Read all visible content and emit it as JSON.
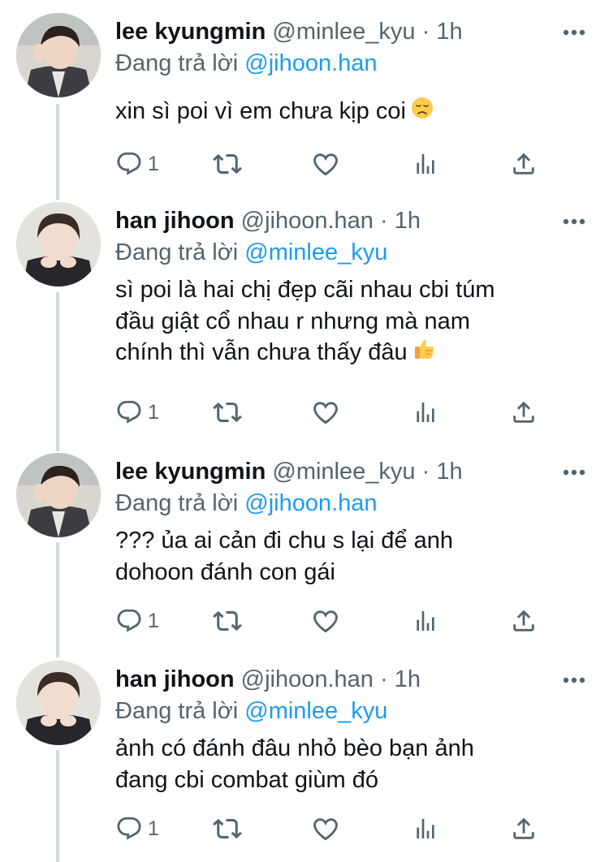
{
  "tweets": [
    {
      "name": "lee kyungmin",
      "handle": "@minlee_kyu",
      "dot": "·",
      "time": "1h",
      "reply_prefix": "Đang trả lời",
      "reply_to": "@jihoon.han",
      "lines": [
        "xin sì poi vì em chưa kịp coi"
      ],
      "emoji": "disappointed-face",
      "reply_count": "1"
    },
    {
      "name": "han jihoon",
      "handle": "@jihoon.han",
      "dot": "·",
      "time": "1h",
      "reply_prefix": "Đang trả lời",
      "reply_to": "@minlee_kyu",
      "lines": [
        "sì poi là hai chị đẹp cãi nhau cbi túm",
        "đầu giật cổ nhau r nhưng mà nam",
        "chính thì vẫn chưa thấy đâu"
      ],
      "emoji": "thumbs-up",
      "reply_count": "1"
    },
    {
      "name": "lee kyungmin",
      "handle": "@minlee_kyu",
      "dot": "·",
      "time": "1h",
      "reply_prefix": "Đang trả lời",
      "reply_to": "@jihoon.han",
      "lines": [
        "??? ủa ai cản đi chu s lại để anh",
        "dohoon đánh con gái"
      ],
      "emoji": "",
      "reply_count": "1"
    },
    {
      "name": "han jihoon",
      "handle": "@jihoon.han",
      "dot": "·",
      "time": "1h",
      "reply_prefix": "Đang trả lời",
      "reply_to": "@minlee_kyu",
      "lines": [
        "ảnh có đánh đâu nhỏ bèo bạn ảnh",
        "đang cbi combat giùm đó"
      ],
      "emoji": "",
      "reply_count": "1"
    }
  ],
  "colors": {
    "accent": "#1d9bf0",
    "secondary_text": "#536471",
    "thread_line": "#cfd9de"
  }
}
